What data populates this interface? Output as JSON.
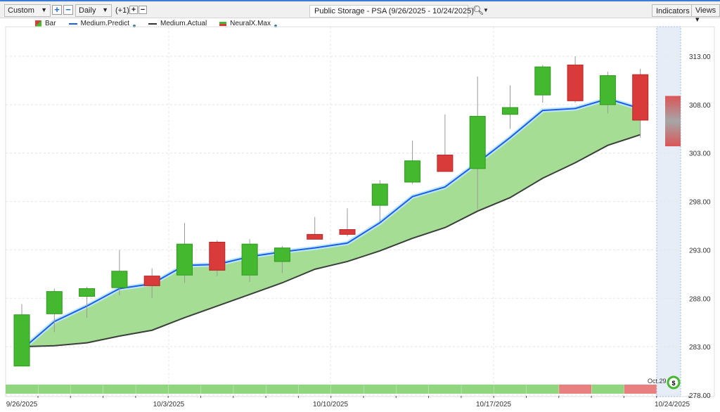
{
  "toolbar": {
    "period": "Custom",
    "interval": "Daily",
    "offset": "(+1)",
    "title": "Public Storage - PSA (9/26/2025 - 10/24/2025)",
    "indicators": "Indicators",
    "views": "Views"
  },
  "legend": {
    "bar": "Bar",
    "predict": "Medium.Predict",
    "actual": "Medium.Actual",
    "neural": "NeuralX.Max"
  },
  "forecast_label": "Oct.29",
  "colors": {
    "up": "#44b82e",
    "down": "#d93a3a",
    "predict": "#1a5fe8",
    "actual": "#3a3f3a",
    "fill": "#9bd98a"
  },
  "chart_data": {
    "type": "candlestick",
    "ylim": [
      278,
      313
    ],
    "yticks": [
      "313.00",
      "308.00",
      "303.00",
      "298.00",
      "293.00",
      "288.00",
      "283.00",
      "278.00"
    ],
    "xlabels": [
      "9/26/2025",
      "10/3/2025",
      "10/10/2025",
      "10/17/2025",
      "10/24/2025"
    ],
    "candles": [
      [
        281,
        286.3,
        287.4,
        281
      ],
      [
        286.4,
        288.7,
        289,
        284.5
      ],
      [
        288.2,
        289,
        289.2,
        286
      ],
      [
        289.1,
        290.8,
        293,
        288.3
      ],
      [
        290.3,
        289.3,
        291.1,
        288
      ],
      [
        290.4,
        293.6,
        295.8,
        289.6
      ],
      [
        293.8,
        290.9,
        294,
        290.3
      ],
      [
        290.4,
        293.6,
        294.1,
        289.7
      ],
      [
        291.8,
        293.2,
        293.4,
        290.6
      ],
      [
        294.6,
        294.1,
        296.4,
        294.1
      ],
      [
        295.1,
        294.6,
        297.3,
        294.4
      ],
      [
        297.6,
        299.8,
        300.2,
        295.9
      ],
      [
        300,
        302.2,
        304.3,
        299.8
      ],
      [
        302.8,
        301.1,
        307,
        301.1
      ],
      [
        301.4,
        306.8,
        310.9,
        297.2
      ],
      [
        307,
        307.7,
        310,
        305.5
      ],
      [
        309,
        311.9,
        312.1,
        308.2
      ],
      [
        312.1,
        308.4,
        313,
        308.2
      ],
      [
        308,
        311,
        311.4,
        307.1
      ],
      [
        311.1,
        306.4,
        311.7,
        304.6
      ]
    ],
    "predict": [
      282.7,
      285.6,
      287.2,
      289,
      289.5,
      291.4,
      291.5,
      292.3,
      292.8,
      293.2,
      293.7,
      295.8,
      298.5,
      299.5,
      302,
      304.6,
      307.4,
      307.6,
      308.6,
      307.6
    ],
    "actual": [
      283,
      283.1,
      283.4,
      284.1,
      284.7,
      286,
      287.2,
      288.4,
      289.6,
      291,
      291.8,
      292.9,
      294.2,
      295.3,
      297,
      298.4,
      300.4,
      302,
      303.8,
      304.9
    ],
    "forecast_range": [
      303.7,
      308.9
    ],
    "signal_strip": [
      "up",
      "up",
      "up",
      "up",
      "up",
      "up",
      "up",
      "up",
      "up",
      "up",
      "up",
      "up",
      "up",
      "up",
      "up",
      "up",
      "up",
      "down",
      "up",
      "down"
    ]
  }
}
